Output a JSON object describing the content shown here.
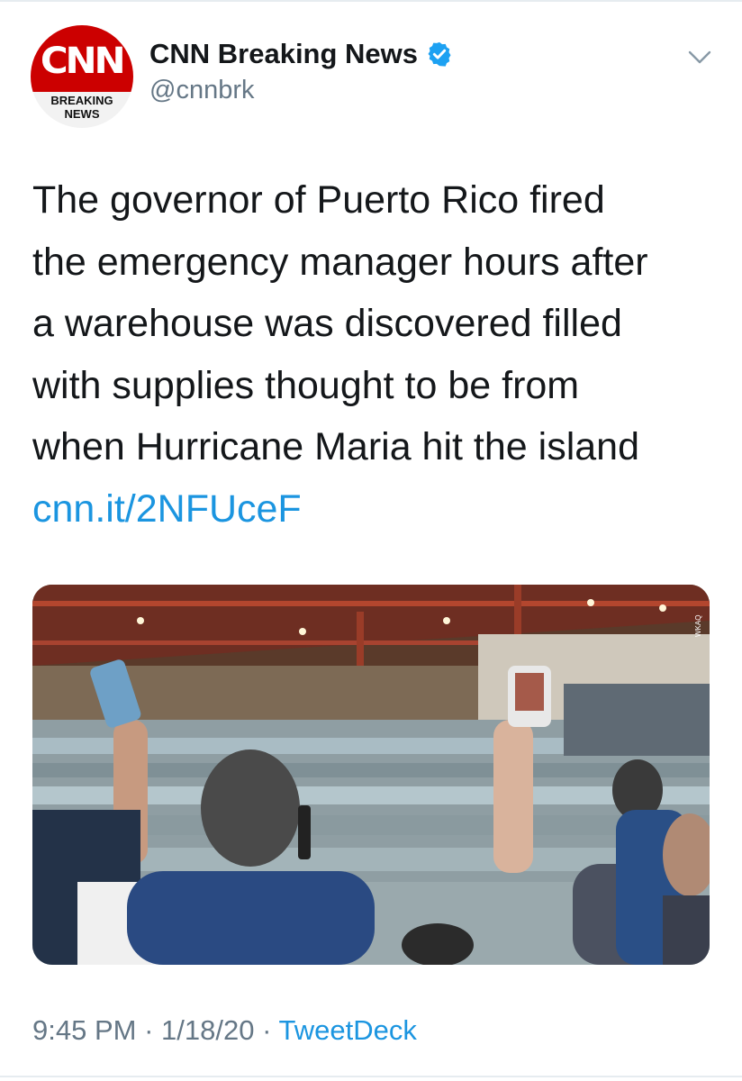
{
  "author": {
    "avatar_logo": "CNN",
    "avatar_sub_line1": "BREAKING",
    "avatar_sub_line2": "NEWS",
    "display_name": "CNN Breaking News",
    "handle": "@cnnbrk",
    "verified": true
  },
  "tweet": {
    "lines": [
      "The governor of Puerto Rico fired",
      "the emergency manager hours after",
      "a warehouse was discovered filled",
      "with supplies thought to be from",
      "when Hurricane Maria hit the island"
    ],
    "link": "cnn.it/2NFUceF"
  },
  "media": {
    "icon": "photo-warehouse",
    "corner_watermark": "WKAQ"
  },
  "meta": {
    "time": "9:45 PM",
    "separator": "·",
    "date": "1/18/20",
    "source": "TweetDeck"
  },
  "colors": {
    "link": "#1b95e0",
    "secondary_text": "#657786",
    "cnn_red": "#cc0000",
    "verified_blue": "#1da1f2"
  }
}
